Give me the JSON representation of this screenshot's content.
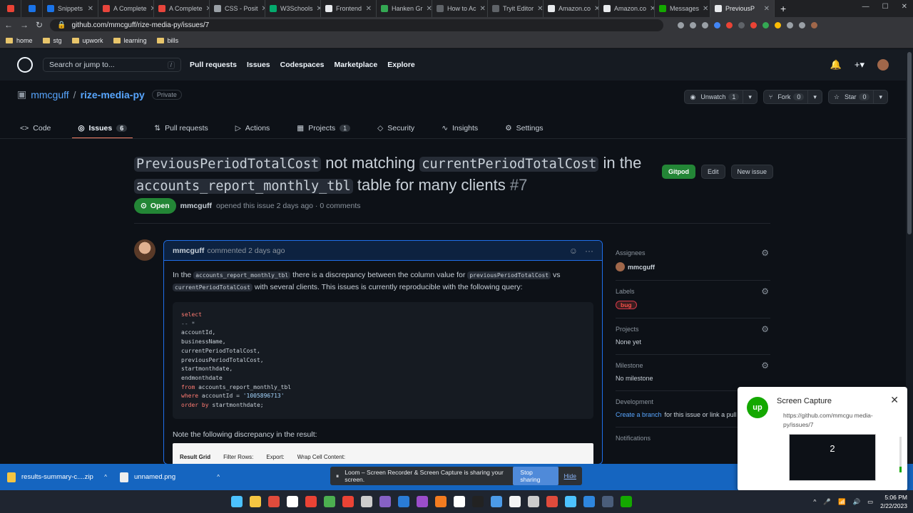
{
  "browser": {
    "tabs": [
      {
        "label": "",
        "color": "#ea4335"
      },
      {
        "label": "",
        "color": "#1a73e8"
      },
      {
        "label": "Snippets",
        "color": "#1a73e8"
      },
      {
        "label": "A Complete",
        "color": "#e8453c"
      },
      {
        "label": "A Complete",
        "color": "#e8453c"
      },
      {
        "label": "CSS - Posit",
        "color": "#9aa0a6"
      },
      {
        "label": "W3Schools",
        "color": "#04aa6d"
      },
      {
        "label": "Frontend",
        "color": "#e8eaed"
      },
      {
        "label": "Hanken Gr",
        "color": "#34a853"
      },
      {
        "label": "How to Ac",
        "color": "#5f6368"
      },
      {
        "label": "Tryit Editor",
        "color": "#5f6368"
      },
      {
        "label": "Amazon.co",
        "color": "#e8eaed"
      },
      {
        "label": "Amazon.co",
        "color": "#e8eaed"
      },
      {
        "label": "Messages",
        "color": "#14a800"
      },
      {
        "label": "PreviousP",
        "color": "#e8eaed",
        "active": true
      }
    ],
    "url": "github.com/mmcguff/rize-media-py/issues/7",
    "bookmarks": [
      "home",
      "stg",
      "upwork",
      "learning",
      "bills"
    ]
  },
  "github": {
    "search_placeholder": "Search or jump to...",
    "search_key": "/",
    "nav": [
      "Pull requests",
      "Issues",
      "Codespaces",
      "Marketplace",
      "Explore"
    ]
  },
  "repo": {
    "owner": "mmcguff",
    "name": "rize-media-py",
    "visibility": "Private",
    "unwatch": "Unwatch",
    "unwatch_count": "1",
    "fork": "Fork",
    "fork_count": "0",
    "star": "Star",
    "star_count": "0",
    "tabs": [
      {
        "label": "Code",
        "icon": "<>",
        "count": ""
      },
      {
        "label": "Issues",
        "icon": "◎",
        "count": "6",
        "active": true
      },
      {
        "label": "Pull requests",
        "icon": "⇅",
        "count": ""
      },
      {
        "label": "Actions",
        "icon": "▷",
        "count": ""
      },
      {
        "label": "Projects",
        "icon": "▦",
        "count": "1"
      },
      {
        "label": "Security",
        "icon": "◇",
        "count": ""
      },
      {
        "label": "Insights",
        "icon": "∿",
        "count": ""
      },
      {
        "label": "Settings",
        "icon": "⚙",
        "count": ""
      }
    ]
  },
  "issue": {
    "code1": "PreviousPeriodTotalCost",
    "t1": " not matching ",
    "code2": "currentPeriodTotalCost",
    "t2": " in the ",
    "code3": "accounts_report_monthly_tbl",
    "t3": " table for many clients ",
    "number": "#7",
    "gitpod": "Gitpod",
    "edit": "Edit",
    "new_issue": "New issue",
    "state": "Open",
    "author": "mmcguff",
    "meta_text": "opened this issue 2 days ago · 0 comments"
  },
  "comment": {
    "author": "mmcguff",
    "time": "commented 2 days ago",
    "p_in": "In the",
    "p_code1": "accounts_report_monthly_tbl",
    "p_mid": "there is a discrepancy between the column value for",
    "p_code2": "previousPeriodTotalCost",
    "p_vs": "vs",
    "p_code3": "currentPeriodTotalCost",
    "p_end": "with several clients. This issues is currently reproducible with the following query:",
    "sql": {
      "l1": "select",
      "l2": "-- *",
      "l3": "accountId,",
      "l4": "businessName,",
      "l5": "currentPeriodTotalCost,",
      "l6": "previousPeriodTotalCost,",
      "l7": "startmonthdate,",
      "l8": "endmonthdate",
      "l9_kw": "from",
      "l9": " accounts_report_monthly_tbl",
      "l10_kw": "where",
      "l10": " accountId = ",
      "l10_str": "'1005896713'",
      "l11_kw": "order by",
      "l11": " startmonthdate;"
    },
    "note": "Note the following discrepancy in the result:",
    "grid": [
      "Result Grid",
      "Filter Rows:",
      "Export:",
      "Wrap Cell Content:"
    ]
  },
  "sidebar": {
    "assignees_label": "Assignees",
    "assignee": "mmcguff",
    "labels_label": "Labels",
    "label": "bug",
    "projects_label": "Projects",
    "projects_val": "None yet",
    "milestone_label": "Milestone",
    "milestone_val": "No milestone",
    "development_label": "Development",
    "dev_link": "Create a branch",
    "dev_text": " for this issue or link a pull re",
    "notifications_label": "Notifications"
  },
  "popup": {
    "logo": "up",
    "title": "Screen Capture",
    "url": "https://github.com/mmcgu media-py/issues/7",
    "thumb": "2"
  },
  "downloads": [
    {
      "name": "results-summary-c....zip"
    },
    {
      "name": "unnamed.png"
    }
  ],
  "loom": {
    "text": "Loom – Screen Recorder & Screen Capture is sharing your screen.",
    "stop": "Stop sharing",
    "hide": "Hide"
  },
  "taskbar": {
    "time": "5:06 PM",
    "date": "2/22/2023",
    "icon_colors": [
      "#4cc2ff",
      "#f4c542",
      "#e04b3c",
      "#ffffff",
      "#ea4335",
      "#4caf50",
      "#ea4335",
      "#cccccc",
      "#8661c5",
      "#2a7cd6",
      "#9b4dca",
      "#f47c20",
      "#ffffff",
      "#222222",
      "#4c9be8",
      "#f4f4f4",
      "#cccccc",
      "#e04b3c",
      "#4cc2ff",
      "#2e86de",
      "#4a5d7a",
      "#14a800"
    ]
  }
}
